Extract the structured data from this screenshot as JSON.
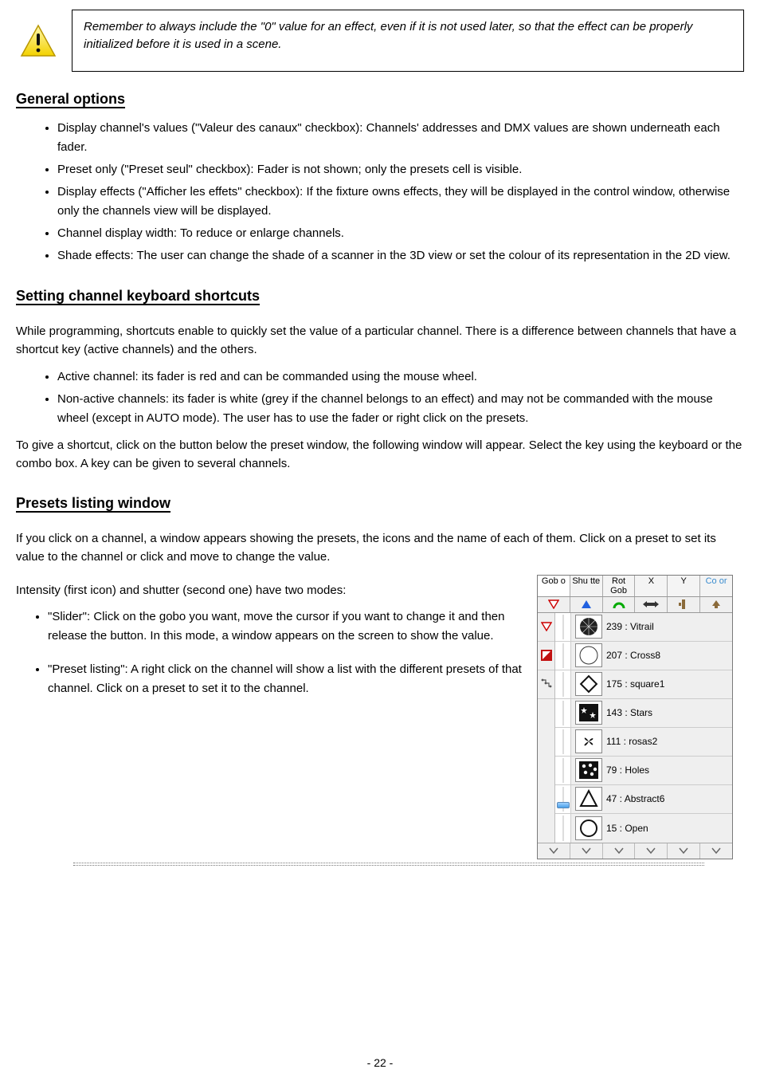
{
  "warning": {
    "text": "Remember to always include the \"0\" value for an effect, even if it is not used later, so that the effect can be properly initialized before it is used in a scene."
  },
  "sections": {
    "general_options": {
      "title": "General options",
      "bullets": [
        "Display channel's values (\"Valeur des canaux\" checkbox): Channels' addresses and DMX values are shown underneath each fader.",
        "Preset only (\"Preset seul\" checkbox): Fader is not shown; only the presets cell is visible.",
        "Display effects (\"Afficher les effets\" checkbox): If the fixture owns effects, they will be displayed in the control window, otherwise only the channels view will be displayed.",
        "Channel display width: To reduce or enlarge channels.",
        "Shade effects: The user can change the shade of a scanner in the 3D view or set the colour of its representation in the 2D view."
      ]
    },
    "channel_shortcuts": {
      "title": "Setting channel keyboard shortcuts",
      "intro": "While programming, shortcuts enable to quickly set the value of a particular channel. There is a difference between channels that have a shortcut key (active channels) and the others.",
      "bullets": [
        "Active channel: its fader is red and can be commanded using the mouse wheel.",
        "Non-active channels: its fader is white (grey if the channel belongs to an effect) and may not be commanded with the mouse wheel (except in AUTO mode). The user has to use the fader or right click on the presets."
      ],
      "outro": "To give a shortcut, click on the button below the preset window, the following window will appear. Select the key using the keyboard or the combo box. A key can be given to several channels."
    },
    "presets_listing": {
      "title": "Presets listing window",
      "body_paragraphs": [
        "If you click on a channel, a window appears showing the presets, the icons and the name of each of them. Click on a preset to set its value to the channel or click and move to change the value.",
        "Intensity (first icon) and shutter (second one) have two modes:"
      ],
      "bullets": [
        "\"Slider\": Click on the gobo you want, move the cursor if you want to change it and then release the button. In this mode, a window appears on the screen to show the value.",
        "\"Preset listing\": A right click on the channel will show a list with the different presets of that channel. Click on a preset to set it to the channel."
      ]
    }
  },
  "panel": {
    "tabs": [
      "Gob o",
      "Shu tte",
      "Rot Gob",
      "X",
      "Y",
      "Co or"
    ],
    "rows": [
      {
        "label": "239 : Vitrail"
      },
      {
        "label": "207 : Cross8"
      },
      {
        "label": "175 : square1"
      },
      {
        "label": "143 : Stars"
      },
      {
        "label": "111 : rosas2"
      },
      {
        "label": "79 : Holes"
      },
      {
        "label": "47 : Abstract6"
      },
      {
        "label": "15 : Open"
      }
    ]
  },
  "footer": {
    "page": "- 22 -"
  }
}
